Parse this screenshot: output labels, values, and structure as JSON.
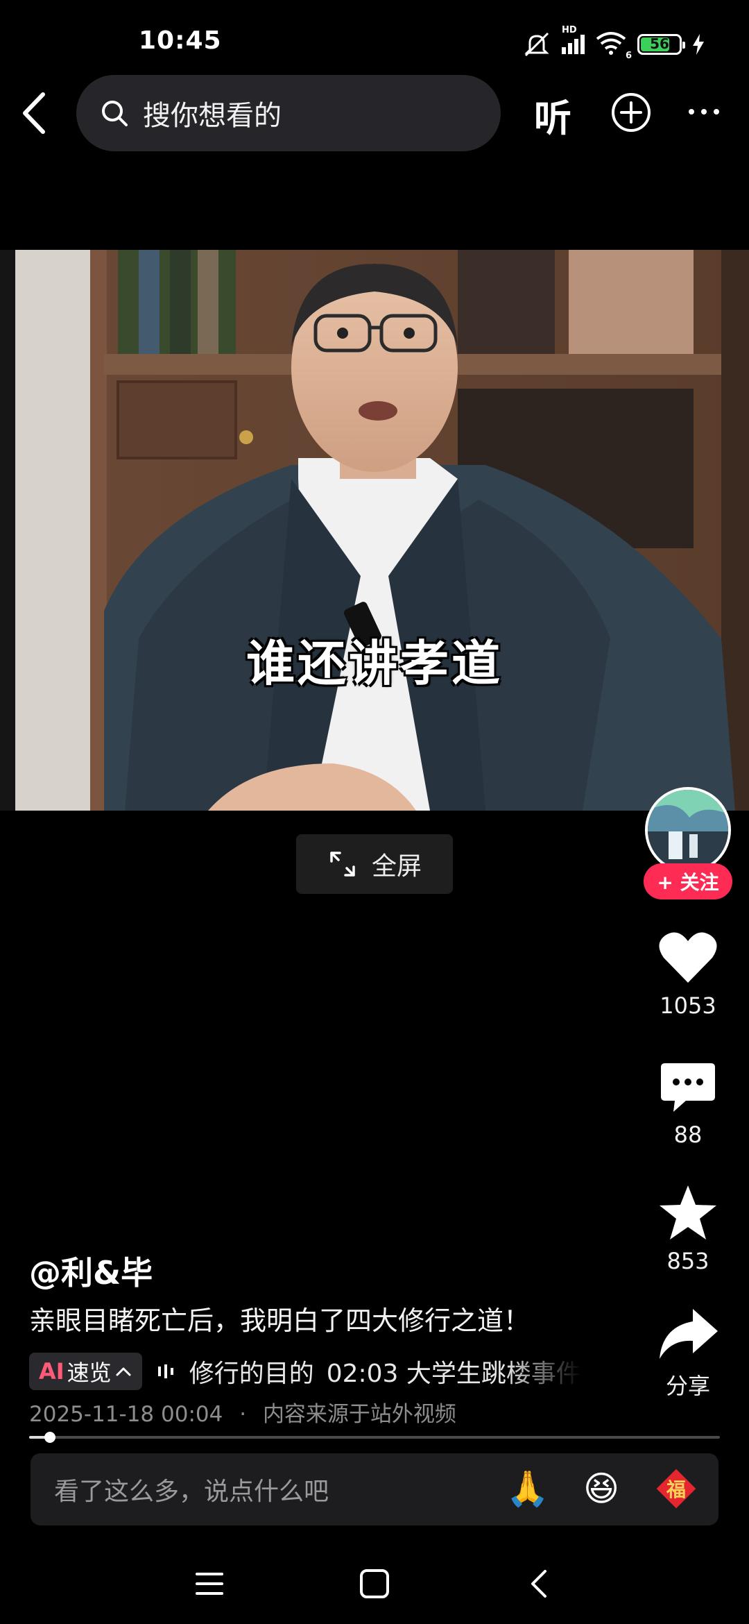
{
  "status_bar": {
    "time": "10:45",
    "network_label": "HD",
    "wifi_label": "6",
    "battery_level": "56"
  },
  "top_bar": {
    "search_placeholder": "搜你想看的",
    "listen_label": "听"
  },
  "video": {
    "subtitle": "谁还讲孝道",
    "fullscreen_label": "全屏",
    "progress_fraction": 0.03
  },
  "right_rail": {
    "follow_label": "+ 关注",
    "likes": "1053",
    "comments": "88",
    "favorites": "853",
    "share_label": "分享"
  },
  "post": {
    "author": "@利&毕",
    "caption": "亲眼目睹死亡后，我明白了四大修行之道！",
    "ai_badge_prefix": "AI",
    "ai_badge_label": "速览",
    "ai_chapter_1": "修行的目的",
    "ai_chapter_2": "02:03 大学生跳楼事件",
    "timestamp": "2025-11-18 00:04",
    "separator": "·",
    "source_note": "内容来源于站外视频"
  },
  "comment_bar": {
    "placeholder": "看了这么多，说点什么吧",
    "emoji_1": "🙏",
    "emoji_2": "😆",
    "emoji_3_text": "福"
  },
  "colors": {
    "accent": "#fe2c55",
    "background": "#000000"
  }
}
